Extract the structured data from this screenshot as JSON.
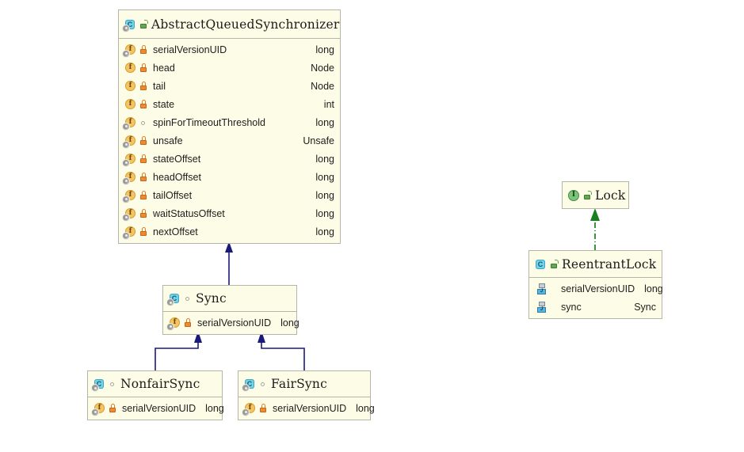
{
  "diagram": {
    "kind": "uml-class-diagram",
    "canvas_bg": "#ffffff",
    "box_bg": "#fdfde7",
    "box_border": "#b6b6a8",
    "inherit_color": "#1a1a7a",
    "realize_color": "#18801e"
  },
  "classes": {
    "aqs": {
      "name": "AbstractQueuedSynchronizer",
      "stereotype": "class",
      "visibility": "public",
      "static": false,
      "members": [
        {
          "name": "serialVersionUID",
          "type": "long",
          "visibility": "private",
          "static": true,
          "kind": "field"
        },
        {
          "name": "head",
          "type": "Node",
          "visibility": "private",
          "static": false,
          "kind": "field"
        },
        {
          "name": "tail",
          "type": "Node",
          "visibility": "private",
          "static": false,
          "kind": "field"
        },
        {
          "name": "state",
          "type": "int",
          "visibility": "private",
          "static": false,
          "kind": "field"
        },
        {
          "name": "spinForTimeoutThreshold",
          "type": "long",
          "visibility": "package",
          "static": true,
          "kind": "field"
        },
        {
          "name": "unsafe",
          "type": "Unsafe",
          "visibility": "private",
          "static": true,
          "kind": "field"
        },
        {
          "name": "stateOffset",
          "type": "long",
          "visibility": "private",
          "static": true,
          "kind": "field"
        },
        {
          "name": "headOffset",
          "type": "long",
          "visibility": "private",
          "static": true,
          "kind": "field"
        },
        {
          "name": "tailOffset",
          "type": "long",
          "visibility": "private",
          "static": true,
          "kind": "field"
        },
        {
          "name": "waitStatusOffset",
          "type": "long",
          "visibility": "private",
          "static": true,
          "kind": "field"
        },
        {
          "name": "nextOffset",
          "type": "long",
          "visibility": "private",
          "static": true,
          "kind": "field"
        }
      ]
    },
    "sync": {
      "name": "Sync",
      "stereotype": "class",
      "visibility": "package",
      "static": true,
      "members": [
        {
          "name": "serialVersionUID",
          "type": "long",
          "visibility": "private",
          "static": true,
          "kind": "field"
        }
      ]
    },
    "nonfair": {
      "name": "NonfairSync",
      "stereotype": "class",
      "visibility": "package",
      "static": true,
      "members": [
        {
          "name": "serialVersionUID",
          "type": "long",
          "visibility": "private",
          "static": true,
          "kind": "field"
        }
      ]
    },
    "fair": {
      "name": "FairSync",
      "stereotype": "class",
      "visibility": "package",
      "static": true,
      "members": [
        {
          "name": "serialVersionUID",
          "type": "long",
          "visibility": "private",
          "static": true,
          "kind": "field"
        }
      ]
    },
    "lock": {
      "name": "Lock",
      "stereotype": "interface",
      "visibility": "public",
      "static": false,
      "members": []
    },
    "reentrant": {
      "name": "ReentrantLock",
      "stereotype": "class",
      "visibility": "public",
      "static": false,
      "members": [
        {
          "name": "serialVersionUID",
          "type": "long",
          "visibility": "none",
          "static": false,
          "kind": "jfield"
        },
        {
          "name": "sync",
          "type": "Sync",
          "visibility": "none",
          "static": false,
          "kind": "jfield"
        }
      ]
    }
  },
  "relations": [
    {
      "from": "Sync",
      "to": "AbstractQueuedSynchronizer",
      "type": "generalization",
      "style": "solid",
      "color": "#1a1a7a"
    },
    {
      "from": "NonfairSync",
      "to": "Sync",
      "type": "generalization",
      "style": "solid",
      "color": "#1a1a7a"
    },
    {
      "from": "FairSync",
      "to": "Sync",
      "type": "generalization",
      "style": "solid",
      "color": "#1a1a7a"
    },
    {
      "from": "ReentrantLock",
      "to": "Lock",
      "type": "realization",
      "style": "dash-dot",
      "color": "#18801e"
    }
  ]
}
